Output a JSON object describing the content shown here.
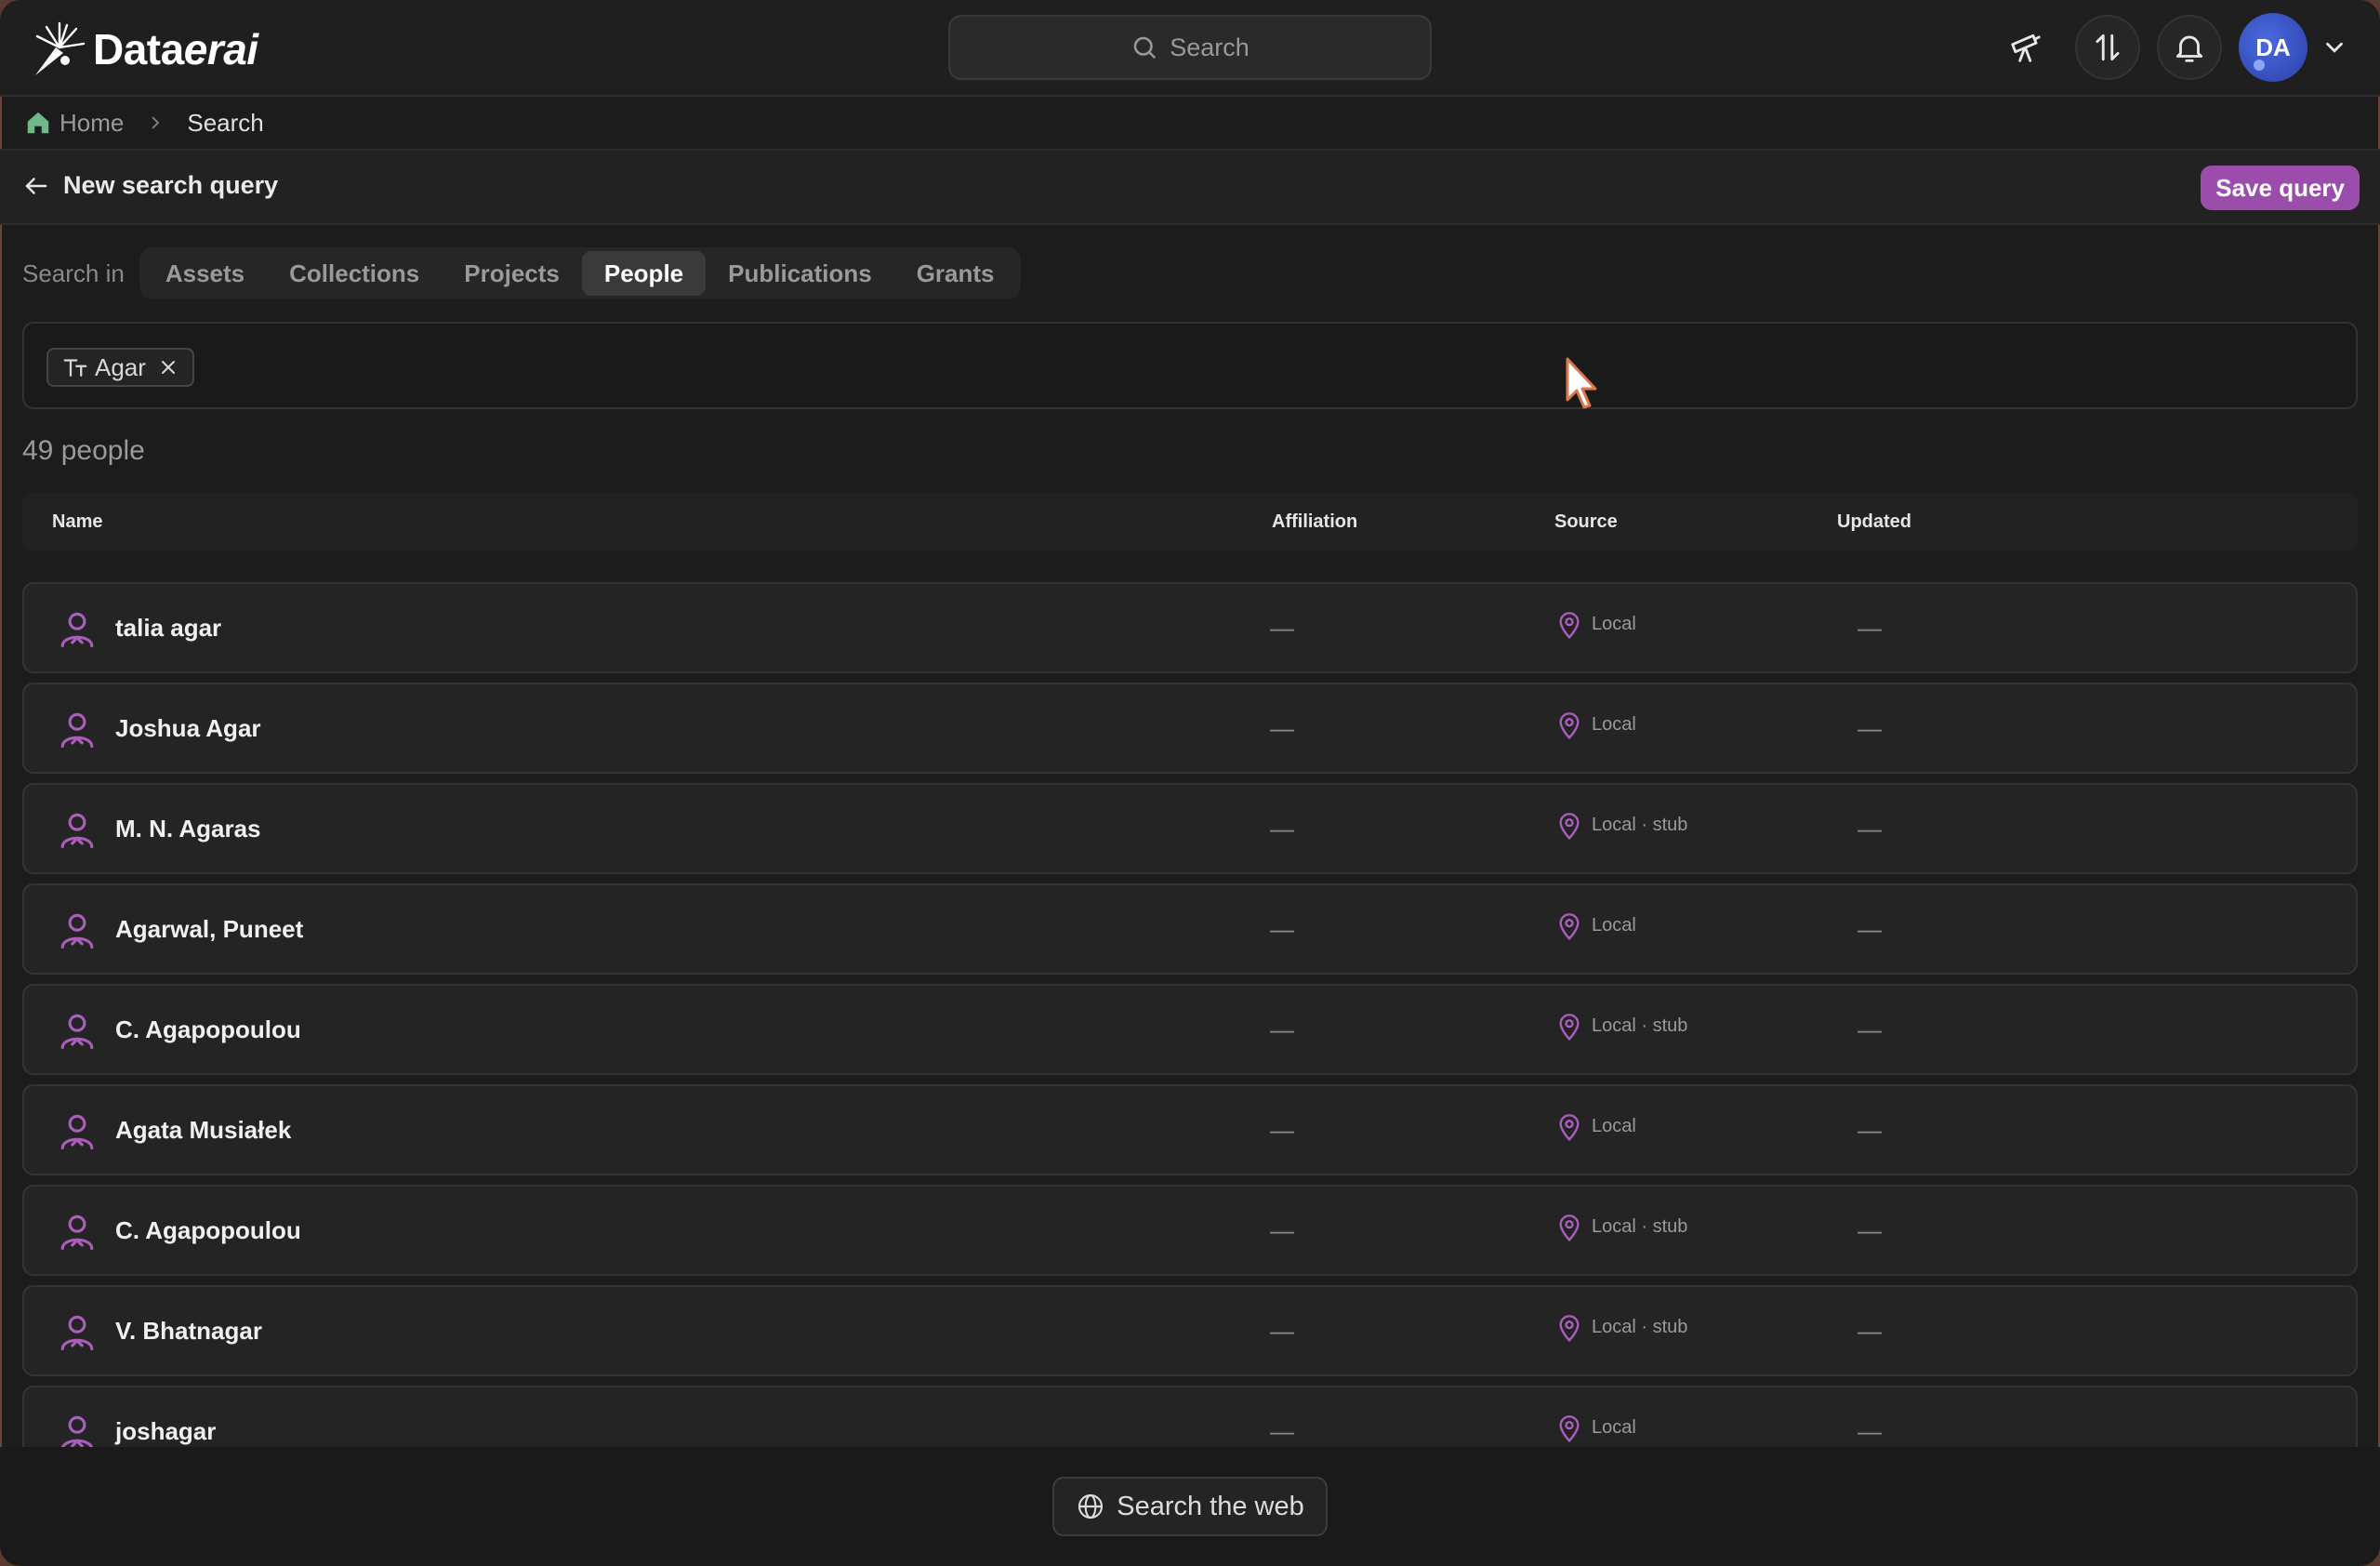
{
  "app": {
    "brand_plain": "Data",
    "brand_italic": "erai"
  },
  "header": {
    "search_label": "Search",
    "user_initials": "DA",
    "colors": {
      "accent": "#9b4dab",
      "avatar": "#3a53c4"
    }
  },
  "breadcrumb": {
    "home": "Home",
    "current": "Search"
  },
  "titlebar": {
    "back_label": "New search query",
    "save_label": "Save query"
  },
  "tabs": {
    "prefix": "Search in",
    "items": [
      {
        "label": "Assets",
        "active": false
      },
      {
        "label": "Collections",
        "active": false
      },
      {
        "label": "Projects",
        "active": false
      },
      {
        "label": "People",
        "active": true
      },
      {
        "label": "Publications",
        "active": false
      },
      {
        "label": "Grants",
        "active": false
      }
    ]
  },
  "query": {
    "chip_label": "Agar",
    "chip_icon": "text-type-icon"
  },
  "results": {
    "count_label": "49 people",
    "columns": {
      "name": "Name",
      "affiliation": "Affiliation",
      "source": "Source",
      "updated": "Updated"
    },
    "rows": [
      {
        "name": "talia agar",
        "affiliation": "—",
        "source": "Local",
        "updated": "—"
      },
      {
        "name": "Joshua Agar",
        "affiliation": "—",
        "source": "Local",
        "updated": "—"
      },
      {
        "name": "M. N. Agaras",
        "affiliation": "—",
        "source": "Local · stub",
        "updated": "—"
      },
      {
        "name": "Agarwal, Puneet",
        "affiliation": "—",
        "source": "Local",
        "updated": "—"
      },
      {
        "name": "C. Agapopoulou",
        "affiliation": "—",
        "source": "Local · stub",
        "updated": "—"
      },
      {
        "name": "Agata Musiałek",
        "affiliation": "—",
        "source": "Local",
        "updated": "—"
      },
      {
        "name": "C. Agapopoulou",
        "affiliation": "—",
        "source": "Local · stub",
        "updated": "—"
      },
      {
        "name": "V. Bhatnagar",
        "affiliation": "—",
        "source": "Local · stub",
        "updated": "—"
      },
      {
        "name": "joshagar",
        "affiliation": "—",
        "source": "Local",
        "updated": "—"
      }
    ]
  },
  "footer": {
    "web_search_label": "Search the web"
  }
}
